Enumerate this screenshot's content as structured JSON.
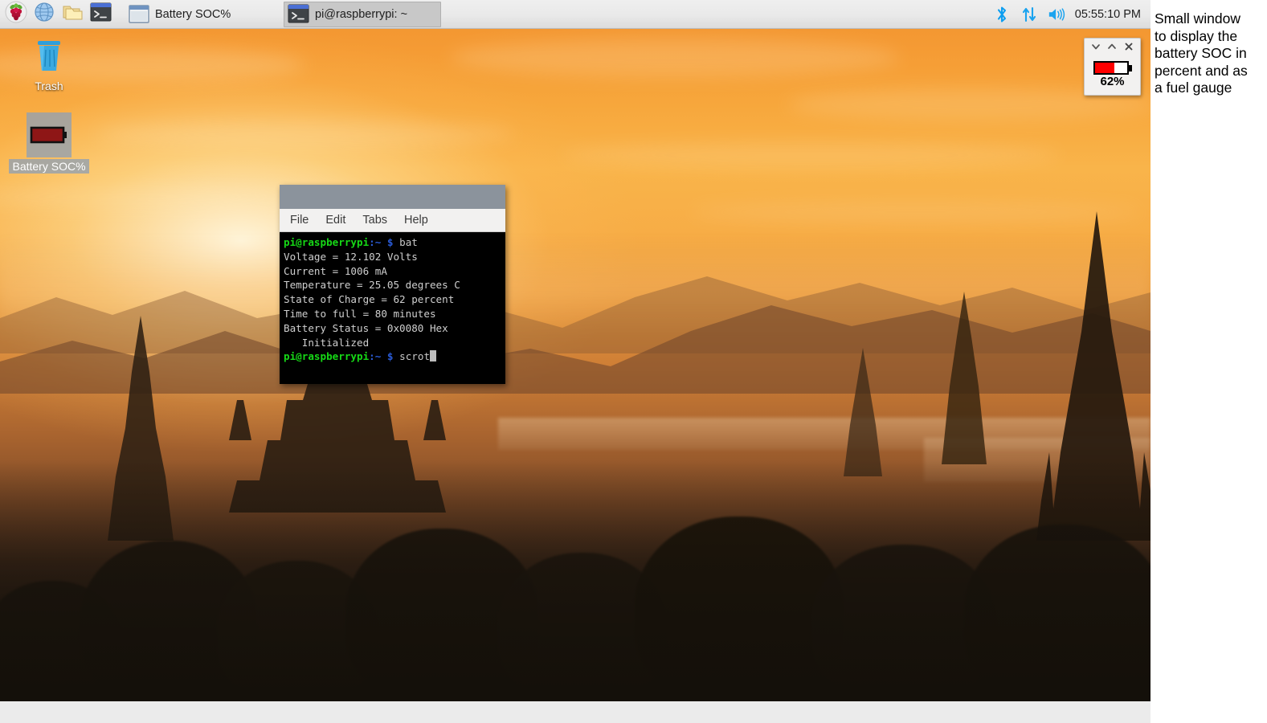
{
  "taskbar": {
    "launchers": [
      {
        "name": "raspberry-menu",
        "icon": "raspberry-icon",
        "label": "Menu"
      },
      {
        "name": "web-browser",
        "icon": "globe-icon",
        "label": "Web Browser"
      },
      {
        "name": "file-manager",
        "icon": "folder-icon",
        "label": "File Manager"
      },
      {
        "name": "terminal-launcher",
        "icon": "terminal-icon",
        "label": "Terminal"
      }
    ],
    "tasks": [
      {
        "name": "task-battery-soc",
        "label": "Battery SOC%",
        "icon": "window-icon",
        "active": false
      },
      {
        "name": "task-terminal",
        "label": "pi@raspberrypi: ~",
        "icon": "terminal-icon",
        "active": true
      }
    ],
    "tray": [
      {
        "name": "bluetooth-icon",
        "label": "Bluetooth"
      },
      {
        "name": "network-icon",
        "label": "Network"
      },
      {
        "name": "volume-icon",
        "label": "Volume"
      }
    ],
    "clock": "05:55:10 PM"
  },
  "desktop_icons": [
    {
      "name": "desktop-icon-trash",
      "label": "Trash",
      "icon": "trash-icon",
      "selected": false
    },
    {
      "name": "desktop-icon-battery-soc",
      "label": "Battery SOC%",
      "icon": "battery-icon",
      "selected": true
    }
  ],
  "terminal": {
    "title": "pi@raspberrypi: ~",
    "menu": [
      "File",
      "Edit",
      "Tabs",
      "Help"
    ],
    "prompt_user": "pi@raspberrypi",
    "prompt_path": ":~",
    "prompt_sigil": "$",
    "lines": [
      {
        "type": "prompt",
        "command": "bat"
      },
      {
        "type": "output",
        "text": "Voltage = 12.102 Volts"
      },
      {
        "type": "output",
        "text": "Current = 1006 mA"
      },
      {
        "type": "output",
        "text": "Temperature = 25.05 degrees C"
      },
      {
        "type": "output",
        "text": "State of Charge = 62 percent"
      },
      {
        "type": "output",
        "text": "Time to full = 80 minutes"
      },
      {
        "type": "output",
        "text": "Battery Status = 0x0080 Hex"
      },
      {
        "type": "output",
        "text": "   Initialized"
      },
      {
        "type": "prompt",
        "command": "scrot",
        "cursor": true
      }
    ],
    "readings": {
      "voltage": "12.102 Volts",
      "current": "1006 mA",
      "temperature": "25.05 degrees C",
      "state_of_charge": "62 percent",
      "time_to_full": "80 minutes",
      "battery_status": "0x0080 Hex",
      "battery_status_text": "Initialized"
    }
  },
  "soc_window": {
    "title": "Battery SOC%",
    "percent_label": "62%",
    "percent_value": 62,
    "gauge_fill_color": "#ff0000",
    "buttons": [
      {
        "name": "minimize-button",
        "glyph": "chevron-down-icon"
      },
      {
        "name": "maximize-button",
        "glyph": "chevron-up-icon"
      },
      {
        "name": "close-button",
        "glyph": "close-icon"
      }
    ]
  },
  "annotation": {
    "text": "Small window\nto display the\nbattery SOC in\npercent and as\na fuel gauge"
  }
}
